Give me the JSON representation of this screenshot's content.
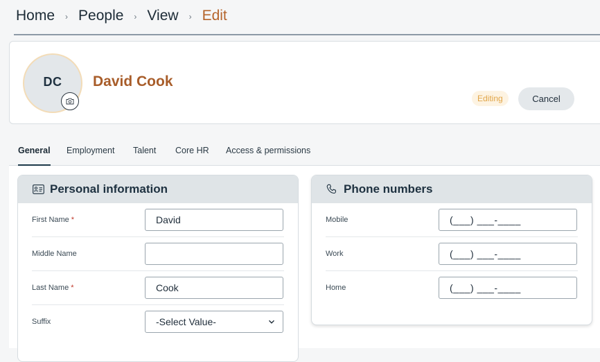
{
  "breadcrumb": {
    "items": [
      "Home",
      "People",
      "View",
      "Edit"
    ],
    "separator": "›"
  },
  "profile": {
    "initials": "DC",
    "name": "David Cook",
    "status": "Editing",
    "cancel_label": "Cancel",
    "camera_icon": "camera-icon"
  },
  "tabs": [
    {
      "label": "General",
      "active": true
    },
    {
      "label": "Employment",
      "active": false
    },
    {
      "label": "Talent",
      "active": false
    },
    {
      "label": "Core HR",
      "active": false
    },
    {
      "label": "Access & permissions",
      "active": false
    }
  ],
  "personal": {
    "title": "Personal information",
    "icon": "id-card-icon",
    "fields": [
      {
        "label": "First Name",
        "required": "*",
        "value": "David"
      },
      {
        "label": "Middle Name",
        "required": "",
        "value": ""
      },
      {
        "label": "Last Name",
        "required": "*",
        "value": "Cook"
      },
      {
        "label": "Suffix",
        "required": "",
        "value": "-Select Value-"
      }
    ]
  },
  "phones": {
    "title": "Phone numbers",
    "icon": "phone-icon",
    "fields": [
      {
        "label": "Mobile",
        "value": "(___) ___-____"
      },
      {
        "label": "Work",
        "value": "(___) ___-____"
      },
      {
        "label": "Home",
        "value": "(___) ___-____"
      }
    ]
  },
  "colors": {
    "accent": "#b5652c",
    "name": "#a85d2a",
    "badge_text": "#e1a548",
    "badge_bg": "#fdf3e2",
    "required": "#c0392b"
  }
}
